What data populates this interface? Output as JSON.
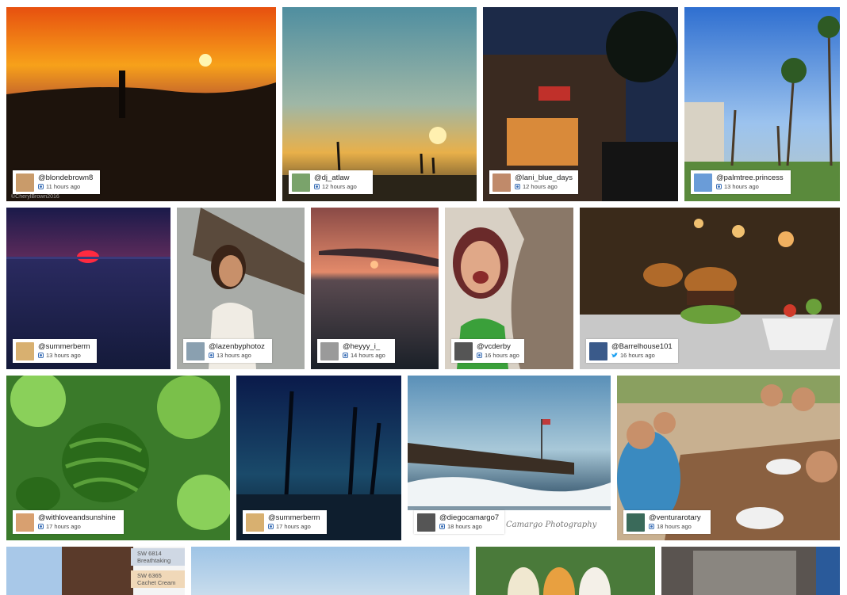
{
  "accent": {
    "instagram": "#3b6fb6",
    "twitter": "#1da1f2"
  },
  "tiles": [
    {
      "user": "@blondebrown8",
      "time": "11 hours ago",
      "source": "instagram-icon",
      "watermark": "©CherylBrown2016"
    },
    {
      "user": "@dj_atlaw",
      "time": "12 hours ago",
      "source": "instagram-icon"
    },
    {
      "user": "@lani_blue_days",
      "time": "12 hours ago",
      "source": "instagram-icon"
    },
    {
      "user": "@palmtree.princess",
      "time": "13 hours ago",
      "source": "instagram-icon"
    },
    {
      "user": "@summerberm",
      "time": "13 hours ago",
      "source": "instagram-icon"
    },
    {
      "user": "@lazenbyphotoz",
      "time": "13 hours ago",
      "source": "instagram-icon"
    },
    {
      "user": "@heyyy_i_",
      "time": "14 hours ago",
      "source": "instagram-icon"
    },
    {
      "user": "@vcderby",
      "time": "16 hours ago",
      "source": "instagram-icon"
    },
    {
      "user": "@Barrelhouse101",
      "time": "16 hours ago",
      "source": "twitter-icon"
    },
    {
      "user": "@withloveandsunshine",
      "time": "17 hours ago",
      "source": "instagram-icon"
    },
    {
      "user": "@summerberm",
      "time": "17 hours ago",
      "source": "instagram-icon"
    },
    {
      "user": "@diegocamargo7",
      "time": "18 hours ago",
      "source": "instagram-icon",
      "signature": "Camargo Photography"
    },
    {
      "user": "@venturarotary",
      "time": "18 hours ago",
      "source": "instagram-icon"
    }
  ],
  "swatches": [
    {
      "code": "SW 6814",
      "name": "Breathtaking"
    },
    {
      "code": "SW 6365",
      "name": "Cachet Cream"
    }
  ]
}
